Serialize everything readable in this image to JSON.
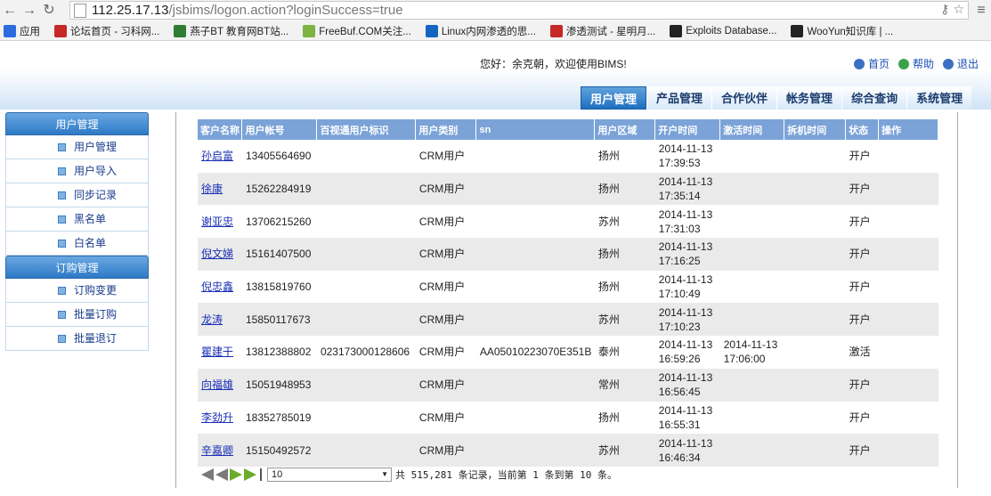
{
  "browser": {
    "url_host": "112.25.17.13",
    "url_path": "/jsbims/logon.action?loginSuccess=true",
    "bookmarks": [
      {
        "label": "应用",
        "color": "#2d6cdf",
        "icon": "apps-grid-icon"
      },
      {
        "label": "论坛首页 - 习科网...",
        "color": "#c62828",
        "icon": "sir-forum-icon"
      },
      {
        "label": "燕子BT 教育网BT站...",
        "color": "#2e7d32",
        "icon": "bt-icon"
      },
      {
        "label": "FreeBuf.COM关注...",
        "color": "#7cb342",
        "icon": "freebuf-icon"
      },
      {
        "label": "Linux内网渗透的思...",
        "color": "#1565c0",
        "icon": "linux-icon"
      },
      {
        "label": "渗透测试 - 星明月...",
        "color": "#c62828",
        "icon": "c-logo-icon"
      },
      {
        "label": "Exploits Database...",
        "color": "#222222",
        "icon": "exploitdb-icon"
      },
      {
        "label": "WooYun知识库 | ...",
        "color": "#222222",
        "icon": "wooyun-icon"
      }
    ]
  },
  "header": {
    "welcome": "您好：余克朝，欢迎使用BIMS!",
    "links": [
      {
        "label": "首页",
        "icon": "home-icon",
        "color": "#3b6fc4"
      },
      {
        "label": "帮助",
        "icon": "help-icon",
        "color": "#3aa34a"
      },
      {
        "label": "退出",
        "icon": "exit-icon",
        "color": "#3b6fc4"
      }
    ],
    "tabs": [
      "用户管理",
      "产品管理",
      "合作伙伴",
      "帐务管理",
      "综合查询",
      "系统管理"
    ],
    "active_tab": "用户管理"
  },
  "sidebar": {
    "sections": [
      {
        "title": "用户管理",
        "items": [
          "用户管理",
          "用户导入",
          "同步记录",
          "黑名单",
          "白名单"
        ]
      },
      {
        "title": "订购管理",
        "items": [
          "订购变更",
          "批量订购",
          "批量退订"
        ]
      }
    ]
  },
  "table": {
    "headers": [
      "客户名称",
      "用户帐号",
      "百视通用户标识",
      "用户类别",
      "sn",
      "用户区域",
      "开户时间",
      "激活时间",
      "拆机时间",
      "状态",
      "操作"
    ],
    "rows": [
      [
        "孙启富",
        "13405564690",
        "",
        "CRM用户",
        "",
        "扬州",
        "2014-11-13\n17:39:53",
        "",
        "",
        "开户",
        ""
      ],
      [
        "徐康",
        "15262284919",
        "",
        "CRM用户",
        "",
        "扬州",
        "2014-11-13\n17:35:14",
        "",
        "",
        "开户",
        ""
      ],
      [
        "谢亚忠",
        "13706215260",
        "",
        "CRM用户",
        "",
        "苏州",
        "2014-11-13\n17:31:03",
        "",
        "",
        "开户",
        ""
      ],
      [
        "倪文娣",
        "15161407500",
        "",
        "CRM用户",
        "",
        "扬州",
        "2014-11-13\n17:16:25",
        "",
        "",
        "开户",
        ""
      ],
      [
        "倪忠鑫",
        "13815819760",
        "",
        "CRM用户",
        "",
        "扬州",
        "2014-11-13\n17:10:49",
        "",
        "",
        "开户",
        ""
      ],
      [
        "龙涛",
        "15850117673",
        "",
        "CRM用户",
        "",
        "苏州",
        "2014-11-13\n17:10:23",
        "",
        "",
        "开户",
        ""
      ],
      [
        "瞿建干",
        "13812388802",
        "023173000128606",
        "CRM用户",
        "AA05010223070E351B",
        "泰州",
        "2014-11-13\n16:59:26",
        "2014-11-13\n17:06:00",
        "",
        "激活",
        ""
      ],
      [
        "向福雄",
        "15051948953",
        "",
        "CRM用户",
        "",
        "常州",
        "2014-11-13\n16:56:45",
        "",
        "",
        "开户",
        ""
      ],
      [
        "李劲升",
        "18352785019",
        "",
        "CRM用户",
        "",
        "扬州",
        "2014-11-13\n16:55:31",
        "",
        "",
        "开户",
        ""
      ],
      [
        "辛嘉卿",
        "15150492572",
        "",
        "CRM用户",
        "",
        "苏州",
        "2014-11-13\n16:46:34",
        "",
        "",
        "开户",
        ""
      ]
    ]
  },
  "pager": {
    "page_size": "10",
    "summary": "共 515,281 条记录，当前第 1 条到第 10 条。"
  }
}
